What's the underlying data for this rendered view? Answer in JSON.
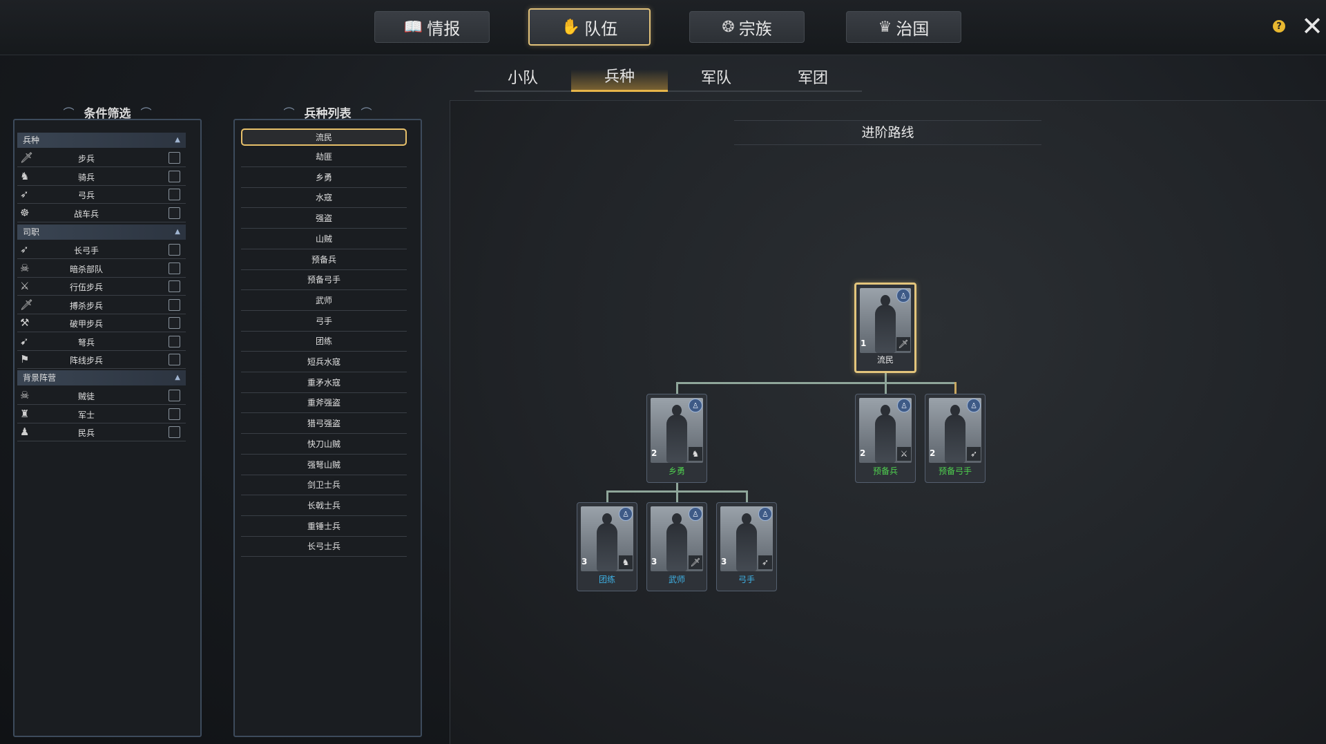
{
  "top_tabs": [
    {
      "label": "情报",
      "icon": "book-icon"
    },
    {
      "label": "队伍",
      "icon": "team-icon",
      "active": true
    },
    {
      "label": "宗族",
      "icon": "clan-icon"
    },
    {
      "label": "治国",
      "icon": "state-icon"
    }
  ],
  "help_label": "?",
  "close_label": "✕",
  "sub_tabs": [
    {
      "label": "小队"
    },
    {
      "label": "兵种",
      "active": true
    },
    {
      "label": "军队"
    },
    {
      "label": "军团"
    }
  ],
  "filter_panel": {
    "title": "条件筛选",
    "groups": [
      {
        "header": "兵种",
        "items": [
          "步兵",
          "骑兵",
          "弓兵",
          "战车兵"
        ]
      },
      {
        "header": "司职",
        "items": [
          "长弓手",
          "暗杀部队",
          "行伍步兵",
          "搏杀步兵",
          "破甲步兵",
          "弩兵",
          "阵线步兵"
        ]
      },
      {
        "header": "背景阵营",
        "items": [
          "贼徒",
          "军士",
          "民兵"
        ]
      }
    ]
  },
  "unit_list": {
    "title": "兵种列表",
    "items": [
      "流民",
      "劫匪",
      "乡勇",
      "水寇",
      "强盗",
      "山贼",
      "预备兵",
      "预备弓手",
      "武师",
      "弓手",
      "团练",
      "短兵水寇",
      "重矛水寇",
      "重斧强盗",
      "猎弓强盗",
      "快刀山贼",
      "强弩山贼",
      "剑卫士兵",
      "长戟士兵",
      "重锤士兵",
      "长弓士兵"
    ],
    "selected": "流民"
  },
  "tree": {
    "title": "进阶路线",
    "nodes": [
      {
        "name": "流民",
        "tier": "1",
        "name_color": "#e8e8e8"
      },
      {
        "name": "乡勇",
        "tier": "2",
        "name_color": "#4fd04f"
      },
      {
        "name": "预备兵",
        "tier": "2",
        "name_color": "#4fd04f"
      },
      {
        "name": "预备弓手",
        "tier": "2",
        "name_color": "#4fd04f"
      },
      {
        "name": "团练",
        "tier": "3",
        "name_color": "#3fb2e6"
      },
      {
        "name": "武师",
        "tier": "3",
        "name_color": "#3fb2e6"
      },
      {
        "name": "弓手",
        "tier": "3",
        "name_color": "#3fb2e6"
      }
    ]
  },
  "colors": {
    "accent": "#e3c57c",
    "panel_border": "#3d4b5c"
  }
}
